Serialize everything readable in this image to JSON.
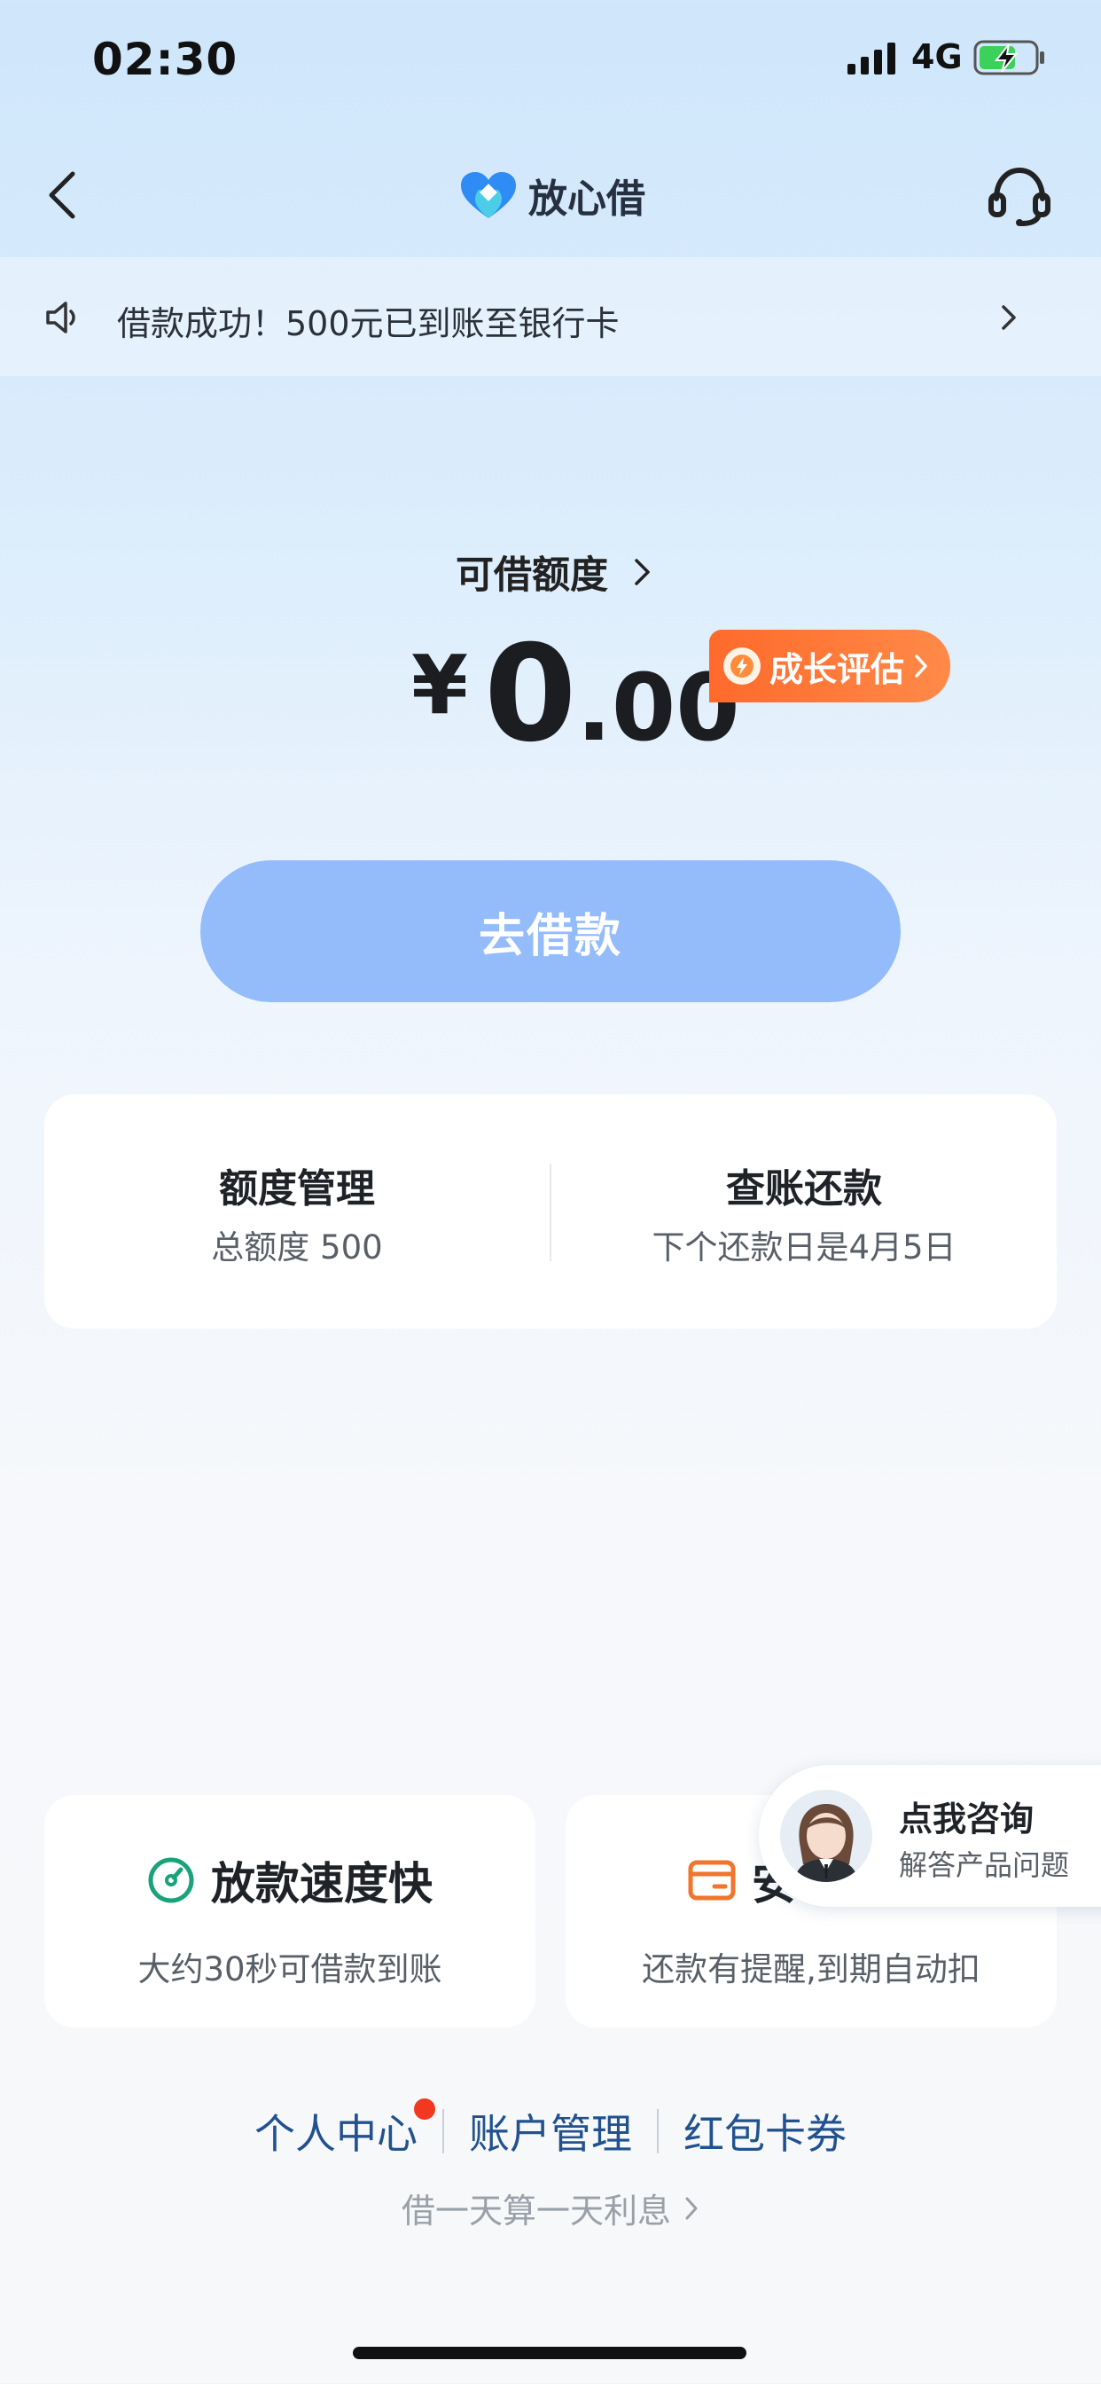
{
  "status_bar": {
    "time": "02:30",
    "network": "4G"
  },
  "nav": {
    "brand": "放心借"
  },
  "notice": {
    "text": "借款成功！500元已到账至银行卡"
  },
  "credit": {
    "label": "可借额度",
    "currency": "¥",
    "amount_int": "0",
    "amount_dec": ".00",
    "growth_label": "成长评估"
  },
  "borrow_button": {
    "label": "去借款"
  },
  "quota_card": {
    "left": {
      "title": "额度管理",
      "sub": "总额度 500"
    },
    "right": {
      "title": "查账还款",
      "sub": "下个还款日是4月5日"
    }
  },
  "features": [
    {
      "title": "放款速度快",
      "sub": "大约30秒可借款到账"
    },
    {
      "title": "安",
      "sub": "还款有提醒,到期自动扣"
    }
  ],
  "consult": {
    "title": "点我咨询",
    "sub": "解答产品问题"
  },
  "footer": {
    "links": [
      "个人中心",
      "账户管理",
      "红包卡券"
    ],
    "interest_note": "借一天算一天利息"
  },
  "colors": {
    "accent_blue": "#94bcfb",
    "growth_orange": "#ff6a2b",
    "link_blue": "#21528f",
    "notification_red": "#f2391f",
    "speed_green": "#1aa37a",
    "card_orange": "#f0752e"
  },
  "icons": [
    "back-arrow-icon",
    "brand-logo-icon",
    "headset-icon",
    "speaker-icon",
    "chevron-right-icon",
    "lightning-icon",
    "speedometer-icon",
    "card-icon"
  ]
}
